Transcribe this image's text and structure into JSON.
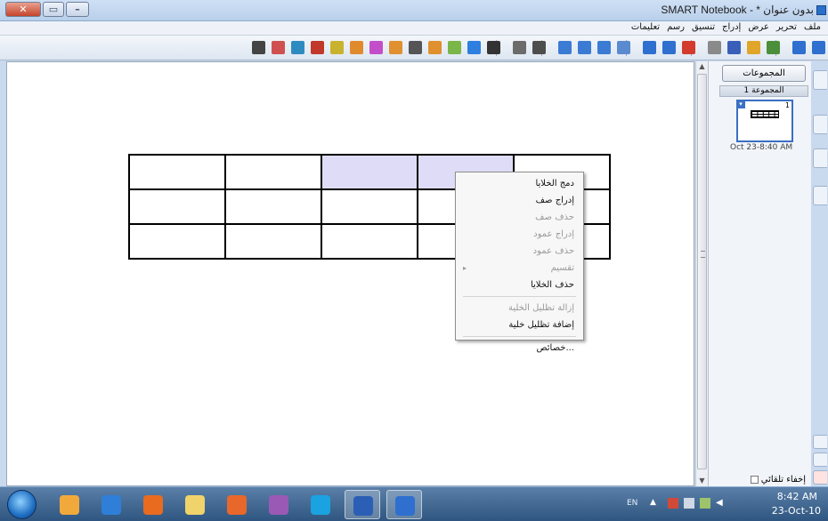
{
  "window": {
    "title": "SMART Notebook - * بدون عنوان",
    "close_label": "✕",
    "max_label": "▭",
    "min_label": "–"
  },
  "menu": [
    "ملف",
    "تحرير",
    "عرض",
    "إدراج",
    "تنسيق",
    "رسم",
    "تعليمات"
  ],
  "toolbar": {
    "icons": [
      "arrow-forward-icon",
      "arrow-back-icon",
      "page-add-icon",
      "open-icon",
      "save-icon",
      "paste-icon",
      "delete-icon",
      "redo-icon",
      "undo-icon",
      "screen-shade-icon",
      "full-screen-icon",
      "dual-display-icon",
      "capture-icon",
      "text-icon",
      "table-icon",
      "select-icon",
      "pen-icon",
      "creative-pen-icon",
      "eraser-icon",
      "line-icon",
      "shape-icon",
      "magic-pen-icon",
      "fill-icon",
      "properties-icon",
      "font-icon",
      "handwriting-icon",
      "stamp-icon",
      "move-toolbar-icon"
    ]
  },
  "table": {
    "rows": 3,
    "cols": 5,
    "selected": [
      [
        0,
        2
      ],
      [
        0,
        3
      ]
    ]
  },
  "context_menu": {
    "items": [
      {
        "label": "دمج الخلايا",
        "disabled": false
      },
      {
        "label": "إدراج صف",
        "disabled": false
      },
      {
        "label": "حذف صف",
        "disabled": true
      },
      {
        "label": "إدراج عمود",
        "disabled": true
      },
      {
        "label": "حذف عمود",
        "disabled": true
      },
      {
        "label": "تقسيم",
        "disabled": true,
        "submenu": true
      },
      {
        "label": "حذف الخلايا",
        "disabled": false
      },
      {
        "separator": true
      },
      {
        "label": "إزالة تظليل الخلية",
        "disabled": true
      },
      {
        "label": "إضافة تظليل خلية",
        "disabled": false
      },
      {
        "separator": true
      },
      {
        "label": "...خصائص",
        "disabled": false
      }
    ]
  },
  "sidepanel": {
    "groups_button": "المجموعات",
    "group_label": "المجموعة 1",
    "page_number": "1",
    "page_date": "Oct 23-8:40 AM",
    "autohide_label": "إخفاء تلقائي"
  },
  "taskbar": {
    "language": "EN",
    "time": "8:42 AM",
    "date": "23-Oct-10",
    "apps": [
      "outlook-icon",
      "internet-explorer-icon",
      "firefox-icon",
      "folder-icon",
      "media-player-icon",
      "messenger-icon",
      "skype-icon",
      "word-icon",
      "smart-notebook-icon"
    ]
  },
  "colors": {
    "selected_cell": "#dedcf7",
    "accent": "#3a6fc4"
  }
}
